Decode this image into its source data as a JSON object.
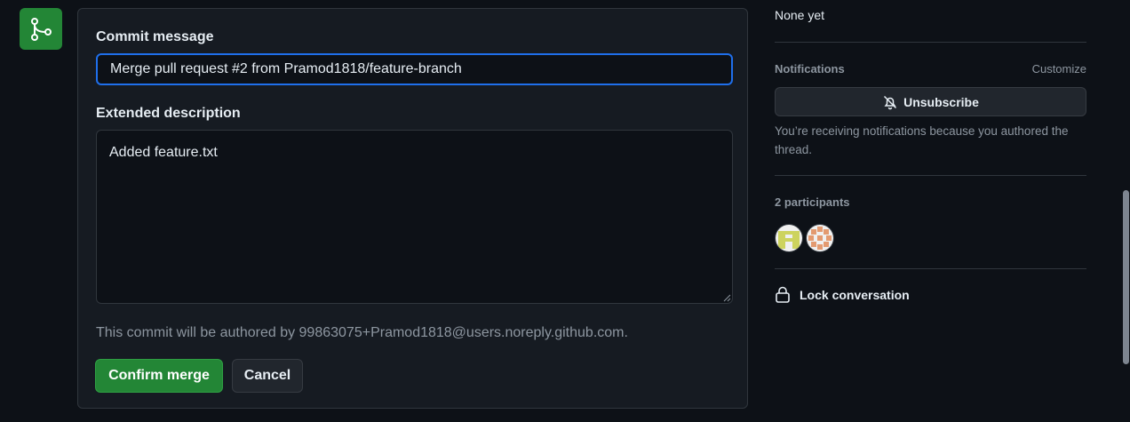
{
  "merge_form": {
    "commit_label": "Commit message",
    "commit_value": "Merge pull request #2 from Pramod1818/feature-branch",
    "description_label": "Extended description",
    "description_value": "Added feature.txt",
    "author_note": "This commit will be authored by 99863075+Pramod1818@users.noreply.github.com.",
    "confirm_label": "Confirm merge",
    "cancel_label": "Cancel"
  },
  "sidebar": {
    "milestone_value": "None yet",
    "notifications_heading": "Notifications",
    "customize_label": "Customize",
    "unsubscribe_label": "Unsubscribe",
    "notification_reason": "You’re receiving notifications because you authored the thread.",
    "participants_heading": "2 participants",
    "lock_label": "Lock conversation"
  },
  "icons": {
    "merge": "git-merge-icon",
    "bell_slash": "bell-slash-icon",
    "lock": "lock-icon"
  },
  "colors": {
    "accent_green": "#238636",
    "focus_blue": "#1f6feb",
    "background": "#0d1117",
    "panel": "#161b22"
  }
}
